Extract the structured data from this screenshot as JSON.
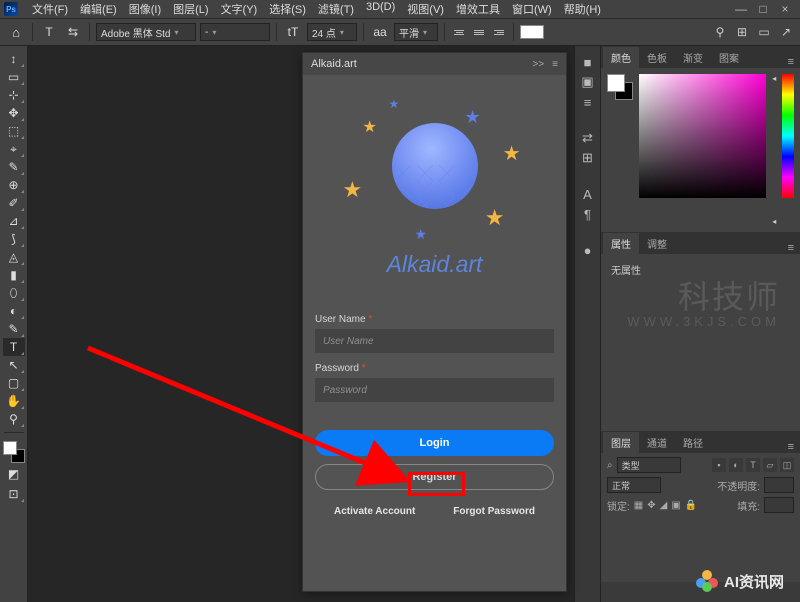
{
  "app": {
    "icon_label": "Ps"
  },
  "menu": [
    "文件(F)",
    "编辑(E)",
    "图像(I)",
    "图层(L)",
    "文字(Y)",
    "选择(S)",
    "滤镜(T)",
    "3D(D)",
    "视图(V)",
    "增效工具",
    "窗口(W)",
    "帮助(H)"
  ],
  "window_controls": {
    "min": "—",
    "max": "□",
    "close": "×"
  },
  "optionbar": {
    "home": "⌂",
    "tool_icon": "T",
    "toggle": "⇆",
    "font_family": "Adobe 黑体 Std",
    "font_style": "-",
    "size_icon": "tT",
    "size_value": "24 点",
    "aa_icon": "aa",
    "aa_value": "平滑",
    "color_label": "",
    "right_icons": [
      "◯",
      "⊞",
      "▭",
      "↗"
    ]
  },
  "tools": [
    "↕",
    "▭",
    "⊹",
    "✥",
    "⬚",
    "⌖",
    "✎",
    "⊕",
    "✐",
    "⊿",
    "⟆",
    "◬",
    "▮",
    "⬯",
    "◐",
    "✎",
    "T",
    "↖",
    "▢",
    "✋",
    "⚲"
  ],
  "plugin": {
    "title": "Alkaid.art",
    "collapse": ">>",
    "menu": "≡",
    "logo_text": "Alkaid.art",
    "username_label": "User Name",
    "username_placeholder": "User Name",
    "password_label": "Password",
    "password_placeholder": "Password",
    "required": "*",
    "login": "Login",
    "register": "Register",
    "activate": "Activate Account",
    "forgot": "Forgot Password"
  },
  "dock_icons": [
    "■",
    "▣",
    "≡",
    "",
    "⇄",
    "⊞",
    "",
    "A",
    "¶",
    "",
    "●"
  ],
  "panel_color": {
    "tabs": [
      "颜色",
      "色板",
      "渐变",
      "图案"
    ],
    "active": 0
  },
  "panel_prop": {
    "tabs": [
      "属性",
      "调整"
    ],
    "active": 0,
    "text": "无属性"
  },
  "panel_layers": {
    "tabs": [
      "图层",
      "通道",
      "路径"
    ],
    "active": 0,
    "type_label": "类型",
    "search": "⌕",
    "blend": "正常",
    "opacity_label": "不透明度:",
    "lock_label": "锁定:",
    "fill_label": "填充:"
  },
  "watermark": {
    "line1": "科技师",
    "line2": "WWW.3KJS.COM"
  },
  "watermark2": "AI资讯网"
}
